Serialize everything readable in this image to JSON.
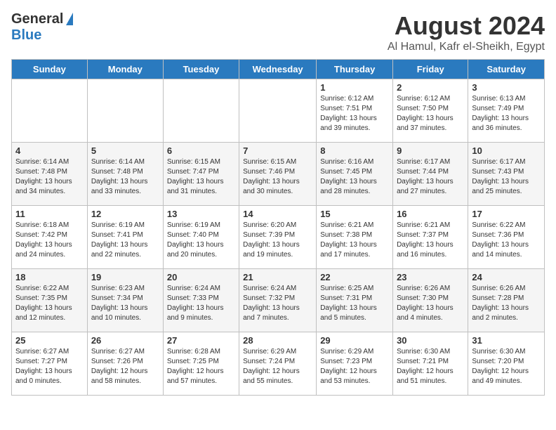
{
  "logo": {
    "general": "General",
    "blue": "Blue"
  },
  "title": {
    "month": "August 2024",
    "location": "Al Hamul, Kafr el-Sheikh, Egypt"
  },
  "headers": [
    "Sunday",
    "Monday",
    "Tuesday",
    "Wednesday",
    "Thursday",
    "Friday",
    "Saturday"
  ],
  "weeks": [
    [
      {
        "day": "",
        "info": ""
      },
      {
        "day": "",
        "info": ""
      },
      {
        "day": "",
        "info": ""
      },
      {
        "day": "",
        "info": ""
      },
      {
        "day": "1",
        "sunrise": "Sunrise: 6:12 AM",
        "sunset": "Sunset: 7:51 PM",
        "daylight": "Daylight: 13 hours and 39 minutes."
      },
      {
        "day": "2",
        "sunrise": "Sunrise: 6:12 AM",
        "sunset": "Sunset: 7:50 PM",
        "daylight": "Daylight: 13 hours and 37 minutes."
      },
      {
        "day": "3",
        "sunrise": "Sunrise: 6:13 AM",
        "sunset": "Sunset: 7:49 PM",
        "daylight": "Daylight: 13 hours and 36 minutes."
      }
    ],
    [
      {
        "day": "4",
        "sunrise": "Sunrise: 6:14 AM",
        "sunset": "Sunset: 7:48 PM",
        "daylight": "Daylight: 13 hours and 34 minutes."
      },
      {
        "day": "5",
        "sunrise": "Sunrise: 6:14 AM",
        "sunset": "Sunset: 7:48 PM",
        "daylight": "Daylight: 13 hours and 33 minutes."
      },
      {
        "day": "6",
        "sunrise": "Sunrise: 6:15 AM",
        "sunset": "Sunset: 7:47 PM",
        "daylight": "Daylight: 13 hours and 31 minutes."
      },
      {
        "day": "7",
        "sunrise": "Sunrise: 6:15 AM",
        "sunset": "Sunset: 7:46 PM",
        "daylight": "Daylight: 13 hours and 30 minutes."
      },
      {
        "day": "8",
        "sunrise": "Sunrise: 6:16 AM",
        "sunset": "Sunset: 7:45 PM",
        "daylight": "Daylight: 13 hours and 28 minutes."
      },
      {
        "day": "9",
        "sunrise": "Sunrise: 6:17 AM",
        "sunset": "Sunset: 7:44 PM",
        "daylight": "Daylight: 13 hours and 27 minutes."
      },
      {
        "day": "10",
        "sunrise": "Sunrise: 6:17 AM",
        "sunset": "Sunset: 7:43 PM",
        "daylight": "Daylight: 13 hours and 25 minutes."
      }
    ],
    [
      {
        "day": "11",
        "sunrise": "Sunrise: 6:18 AM",
        "sunset": "Sunset: 7:42 PM",
        "daylight": "Daylight: 13 hours and 24 minutes."
      },
      {
        "day": "12",
        "sunrise": "Sunrise: 6:19 AM",
        "sunset": "Sunset: 7:41 PM",
        "daylight": "Daylight: 13 hours and 22 minutes."
      },
      {
        "day": "13",
        "sunrise": "Sunrise: 6:19 AM",
        "sunset": "Sunset: 7:40 PM",
        "daylight": "Daylight: 13 hours and 20 minutes."
      },
      {
        "day": "14",
        "sunrise": "Sunrise: 6:20 AM",
        "sunset": "Sunset: 7:39 PM",
        "daylight": "Daylight: 13 hours and 19 minutes."
      },
      {
        "day": "15",
        "sunrise": "Sunrise: 6:21 AM",
        "sunset": "Sunset: 7:38 PM",
        "daylight": "Daylight: 13 hours and 17 minutes."
      },
      {
        "day": "16",
        "sunrise": "Sunrise: 6:21 AM",
        "sunset": "Sunset: 7:37 PM",
        "daylight": "Daylight: 13 hours and 16 minutes."
      },
      {
        "day": "17",
        "sunrise": "Sunrise: 6:22 AM",
        "sunset": "Sunset: 7:36 PM",
        "daylight": "Daylight: 13 hours and 14 minutes."
      }
    ],
    [
      {
        "day": "18",
        "sunrise": "Sunrise: 6:22 AM",
        "sunset": "Sunset: 7:35 PM",
        "daylight": "Daylight: 13 hours and 12 minutes."
      },
      {
        "day": "19",
        "sunrise": "Sunrise: 6:23 AM",
        "sunset": "Sunset: 7:34 PM",
        "daylight": "Daylight: 13 hours and 10 minutes."
      },
      {
        "day": "20",
        "sunrise": "Sunrise: 6:24 AM",
        "sunset": "Sunset: 7:33 PM",
        "daylight": "Daylight: 13 hours and 9 minutes."
      },
      {
        "day": "21",
        "sunrise": "Sunrise: 6:24 AM",
        "sunset": "Sunset: 7:32 PM",
        "daylight": "Daylight: 13 hours and 7 minutes."
      },
      {
        "day": "22",
        "sunrise": "Sunrise: 6:25 AM",
        "sunset": "Sunset: 7:31 PM",
        "daylight": "Daylight: 13 hours and 5 minutes."
      },
      {
        "day": "23",
        "sunrise": "Sunrise: 6:26 AM",
        "sunset": "Sunset: 7:30 PM",
        "daylight": "Daylight: 13 hours and 4 minutes."
      },
      {
        "day": "24",
        "sunrise": "Sunrise: 6:26 AM",
        "sunset": "Sunset: 7:28 PM",
        "daylight": "Daylight: 13 hours and 2 minutes."
      }
    ],
    [
      {
        "day": "25",
        "sunrise": "Sunrise: 6:27 AM",
        "sunset": "Sunset: 7:27 PM",
        "daylight": "Daylight: 13 hours and 0 minutes."
      },
      {
        "day": "26",
        "sunrise": "Sunrise: 6:27 AM",
        "sunset": "Sunset: 7:26 PM",
        "daylight": "Daylight: 12 hours and 58 minutes."
      },
      {
        "day": "27",
        "sunrise": "Sunrise: 6:28 AM",
        "sunset": "Sunset: 7:25 PM",
        "daylight": "Daylight: 12 hours and 57 minutes."
      },
      {
        "day": "28",
        "sunrise": "Sunrise: 6:29 AM",
        "sunset": "Sunset: 7:24 PM",
        "daylight": "Daylight: 12 hours and 55 minutes."
      },
      {
        "day": "29",
        "sunrise": "Sunrise: 6:29 AM",
        "sunset": "Sunset: 7:23 PM",
        "daylight": "Daylight: 12 hours and 53 minutes."
      },
      {
        "day": "30",
        "sunrise": "Sunrise: 6:30 AM",
        "sunset": "Sunset: 7:21 PM",
        "daylight": "Daylight: 12 hours and 51 minutes."
      },
      {
        "day": "31",
        "sunrise": "Sunrise: 6:30 AM",
        "sunset": "Sunset: 7:20 PM",
        "daylight": "Daylight: 12 hours and 49 minutes."
      }
    ]
  ]
}
